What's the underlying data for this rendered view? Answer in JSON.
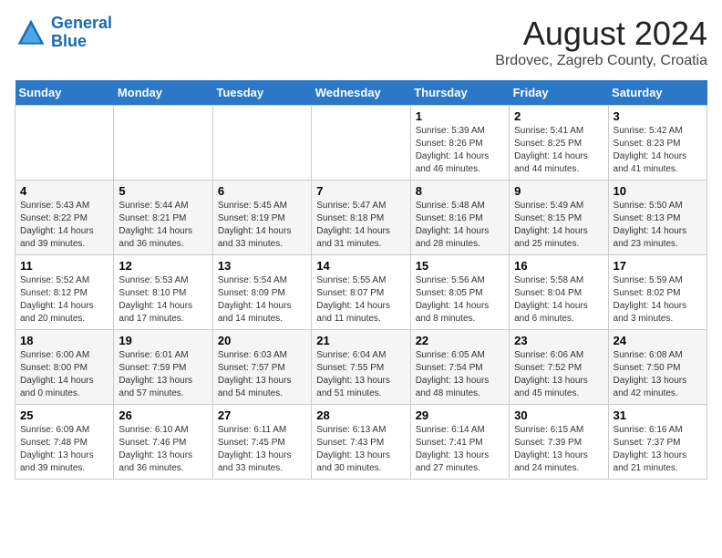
{
  "header": {
    "logo_line1": "General",
    "logo_line2": "Blue",
    "month": "August 2024",
    "location": "Brdovec, Zagreb County, Croatia"
  },
  "weekdays": [
    "Sunday",
    "Monday",
    "Tuesday",
    "Wednesday",
    "Thursday",
    "Friday",
    "Saturday"
  ],
  "weeks": [
    [
      {
        "day": "",
        "info": ""
      },
      {
        "day": "",
        "info": ""
      },
      {
        "day": "",
        "info": ""
      },
      {
        "day": "",
        "info": ""
      },
      {
        "day": "1",
        "info": "Sunrise: 5:39 AM\nSunset: 8:26 PM\nDaylight: 14 hours\nand 46 minutes."
      },
      {
        "day": "2",
        "info": "Sunrise: 5:41 AM\nSunset: 8:25 PM\nDaylight: 14 hours\nand 44 minutes."
      },
      {
        "day": "3",
        "info": "Sunrise: 5:42 AM\nSunset: 8:23 PM\nDaylight: 14 hours\nand 41 minutes."
      }
    ],
    [
      {
        "day": "4",
        "info": "Sunrise: 5:43 AM\nSunset: 8:22 PM\nDaylight: 14 hours\nand 39 minutes."
      },
      {
        "day": "5",
        "info": "Sunrise: 5:44 AM\nSunset: 8:21 PM\nDaylight: 14 hours\nand 36 minutes."
      },
      {
        "day": "6",
        "info": "Sunrise: 5:45 AM\nSunset: 8:19 PM\nDaylight: 14 hours\nand 33 minutes."
      },
      {
        "day": "7",
        "info": "Sunrise: 5:47 AM\nSunset: 8:18 PM\nDaylight: 14 hours\nand 31 minutes."
      },
      {
        "day": "8",
        "info": "Sunrise: 5:48 AM\nSunset: 8:16 PM\nDaylight: 14 hours\nand 28 minutes."
      },
      {
        "day": "9",
        "info": "Sunrise: 5:49 AM\nSunset: 8:15 PM\nDaylight: 14 hours\nand 25 minutes."
      },
      {
        "day": "10",
        "info": "Sunrise: 5:50 AM\nSunset: 8:13 PM\nDaylight: 14 hours\nand 23 minutes."
      }
    ],
    [
      {
        "day": "11",
        "info": "Sunrise: 5:52 AM\nSunset: 8:12 PM\nDaylight: 14 hours\nand 20 minutes."
      },
      {
        "day": "12",
        "info": "Sunrise: 5:53 AM\nSunset: 8:10 PM\nDaylight: 14 hours\nand 17 minutes."
      },
      {
        "day": "13",
        "info": "Sunrise: 5:54 AM\nSunset: 8:09 PM\nDaylight: 14 hours\nand 14 minutes."
      },
      {
        "day": "14",
        "info": "Sunrise: 5:55 AM\nSunset: 8:07 PM\nDaylight: 14 hours\nand 11 minutes."
      },
      {
        "day": "15",
        "info": "Sunrise: 5:56 AM\nSunset: 8:05 PM\nDaylight: 14 hours\nand 8 minutes."
      },
      {
        "day": "16",
        "info": "Sunrise: 5:58 AM\nSunset: 8:04 PM\nDaylight: 14 hours\nand 6 minutes."
      },
      {
        "day": "17",
        "info": "Sunrise: 5:59 AM\nSunset: 8:02 PM\nDaylight: 14 hours\nand 3 minutes."
      }
    ],
    [
      {
        "day": "18",
        "info": "Sunrise: 6:00 AM\nSunset: 8:00 PM\nDaylight: 14 hours\nand 0 minutes."
      },
      {
        "day": "19",
        "info": "Sunrise: 6:01 AM\nSunset: 7:59 PM\nDaylight: 13 hours\nand 57 minutes."
      },
      {
        "day": "20",
        "info": "Sunrise: 6:03 AM\nSunset: 7:57 PM\nDaylight: 13 hours\nand 54 minutes."
      },
      {
        "day": "21",
        "info": "Sunrise: 6:04 AM\nSunset: 7:55 PM\nDaylight: 13 hours\nand 51 minutes."
      },
      {
        "day": "22",
        "info": "Sunrise: 6:05 AM\nSunset: 7:54 PM\nDaylight: 13 hours\nand 48 minutes."
      },
      {
        "day": "23",
        "info": "Sunrise: 6:06 AM\nSunset: 7:52 PM\nDaylight: 13 hours\nand 45 minutes."
      },
      {
        "day": "24",
        "info": "Sunrise: 6:08 AM\nSunset: 7:50 PM\nDaylight: 13 hours\nand 42 minutes."
      }
    ],
    [
      {
        "day": "25",
        "info": "Sunrise: 6:09 AM\nSunset: 7:48 PM\nDaylight: 13 hours\nand 39 minutes."
      },
      {
        "day": "26",
        "info": "Sunrise: 6:10 AM\nSunset: 7:46 PM\nDaylight: 13 hours\nand 36 minutes."
      },
      {
        "day": "27",
        "info": "Sunrise: 6:11 AM\nSunset: 7:45 PM\nDaylight: 13 hours\nand 33 minutes."
      },
      {
        "day": "28",
        "info": "Sunrise: 6:13 AM\nSunset: 7:43 PM\nDaylight: 13 hours\nand 30 minutes."
      },
      {
        "day": "29",
        "info": "Sunrise: 6:14 AM\nSunset: 7:41 PM\nDaylight: 13 hours\nand 27 minutes."
      },
      {
        "day": "30",
        "info": "Sunrise: 6:15 AM\nSunset: 7:39 PM\nDaylight: 13 hours\nand 24 minutes."
      },
      {
        "day": "31",
        "info": "Sunrise: 6:16 AM\nSunset: 7:37 PM\nDaylight: 13 hours\nand 21 minutes."
      }
    ]
  ]
}
